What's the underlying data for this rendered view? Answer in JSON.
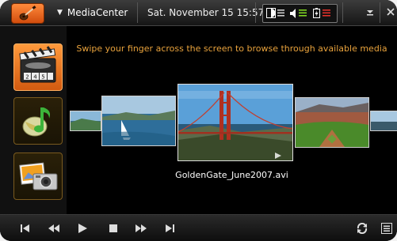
{
  "header": {
    "app_menu_label": "MediaCenter",
    "datetime": "Sat. November 15 15:57"
  },
  "icons": {
    "logo": "guitar-icon",
    "display": "display-mode-icon",
    "volume": "volume-icon",
    "battery": "battery-icon",
    "minimize": "minimize-icon",
    "close": "close-icon"
  },
  "sidebar": {
    "items": [
      {
        "name": "video-category",
        "icon": "clapperboard-icon",
        "active": true
      },
      {
        "name": "music-category",
        "icon": "music-note-icon",
        "active": false
      },
      {
        "name": "photos-category",
        "icon": "camera-icon",
        "active": false
      }
    ]
  },
  "main": {
    "instruction": "Swipe your finger across the screen to browse through available media",
    "selected_caption": "GoldenGate_June2007.avi",
    "thumbnails": [
      "landscape-edge-left",
      "sailboat",
      "golden-gate-bridge",
      "baseball-stadium",
      "landscape-edge-right"
    ]
  },
  "controls": {
    "buttons": [
      "skip-back",
      "rewind",
      "play",
      "stop",
      "fast-forward",
      "skip-forward",
      "repeat",
      "playlist"
    ]
  },
  "colors": {
    "accent": "#e8a23c",
    "active_item": "#f07a2a",
    "bar": "#1a1a1a"
  }
}
